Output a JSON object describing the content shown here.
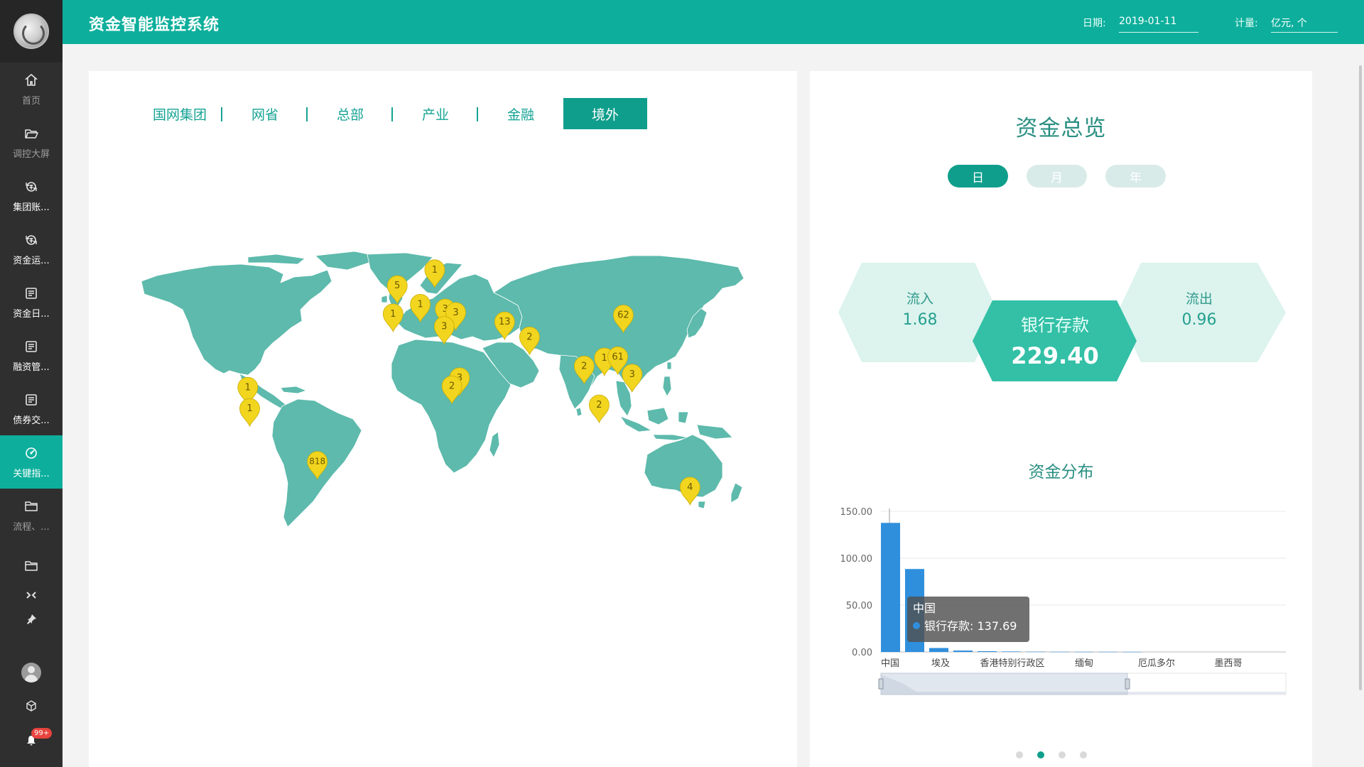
{
  "header": {
    "title": "资金智能监控系统",
    "date_label": "日期:",
    "date_value": "2019-01-11",
    "unit_label": "计量:",
    "unit_value": "亿元, 个"
  },
  "sidebar": {
    "items": [
      {
        "label": "首页",
        "icon": "home-icon"
      },
      {
        "label": "调控大屏",
        "icon": "folder-open-icon"
      },
      {
        "label": "集团账...",
        "icon": "currency-exchange-icon"
      },
      {
        "label": "资金运...",
        "icon": "currency-exchange-icon"
      },
      {
        "label": "资金日...",
        "icon": "report-icon"
      },
      {
        "label": "融资管...",
        "icon": "report-icon"
      },
      {
        "label": "债券交...",
        "icon": "report-icon"
      },
      {
        "label": "关键指...",
        "icon": "gauge-icon"
      },
      {
        "label": "流程、...",
        "icon": "folder-icon"
      },
      {
        "label": "",
        "icon": "folder-icon"
      }
    ],
    "badge": "99+"
  },
  "tabs": [
    "国网集团",
    "网省",
    "总部",
    "产业",
    "金融",
    "境外"
  ],
  "active_tab": "境外",
  "map": {
    "markers": [
      {
        "label": "5",
        "lon": -1.5,
        "lat": 52.5
      },
      {
        "label": "1",
        "lon": 18.0,
        "lat": 59.3
      },
      {
        "label": "1",
        "lon": -3.7,
        "lat": 40.4
      },
      {
        "label": "1",
        "lon": 10.5,
        "lat": 44.5
      },
      {
        "label": "3",
        "lon": 23.5,
        "lat": 42.5
      },
      {
        "label": "3",
        "lon": 29.0,
        "lat": 41.0
      },
      {
        "label": "3",
        "lon": 23.0,
        "lat": 35.0
      },
      {
        "label": "13",
        "lon": 54.5,
        "lat": 37.0
      },
      {
        "label": "2",
        "lon": 67.5,
        "lat": 30.5
      },
      {
        "label": "62",
        "lon": 116.4,
        "lat": 39.9
      },
      {
        "label": "1",
        "lon": 106.5,
        "lat": 21.5
      },
      {
        "label": "61",
        "lon": 113.5,
        "lat": 22.0
      },
      {
        "label": "2",
        "lon": 96.0,
        "lat": 18.0
      },
      {
        "label": "3",
        "lon": 121.0,
        "lat": 14.5
      },
      {
        "label": "3",
        "lon": 31.0,
        "lat": 13.0
      },
      {
        "label": "2",
        "lon": 27.0,
        "lat": 9.5
      },
      {
        "label": "2",
        "lon": 103.8,
        "lat": 1.35
      },
      {
        "label": "1",
        "lon": -79.5,
        "lat": 8.9
      },
      {
        "label": "1",
        "lon": -78.5,
        "lat": -0.2
      },
      {
        "label": "818",
        "lon": -43.2,
        "lat": -22.9
      },
      {
        "label": "4",
        "lon": 151.2,
        "lat": -33.9
      }
    ]
  },
  "overview": {
    "title": "资金总览",
    "periods": [
      "日",
      "月",
      "年"
    ],
    "active_period": "日",
    "inflow_label": "流入",
    "inflow_value": "1.68",
    "deposit_label": "银行存款",
    "deposit_value": "229.40",
    "outflow_label": "流出",
    "outflow_value": "0.96"
  },
  "distribution": {
    "title": "资金分布",
    "tooltip_title": "中国",
    "tooltip_series": "银行存款",
    "tooltip_value": "137.69"
  },
  "colors": {
    "accent": "#0daf9c",
    "map_land": "#5dbaac",
    "marker": "#f2d51e",
    "bar": "#2f8fdd",
    "hex_light": "#dcf3ee",
    "hex_main": "#33c0a6"
  },
  "chart_data": {
    "type": "bar",
    "categories": [
      "中国",
      "",
      "埃及",
      "",
      "香港特别行政区",
      "",
      "缅甸",
      "",
      "厄瓜多尔",
      "",
      "墨西哥"
    ],
    "series": [
      {
        "name": "银行存款",
        "values": [
          137.69,
          88.5,
          4.2,
          1.5,
          0.8,
          0.5,
          0.3,
          0.2,
          0.1,
          0.1,
          0.05
        ]
      }
    ],
    "yticks": [
      "0.00",
      "50.00",
      "100.00",
      "150.00"
    ],
    "ylim": [
      0,
      150
    ],
    "grid": true
  }
}
